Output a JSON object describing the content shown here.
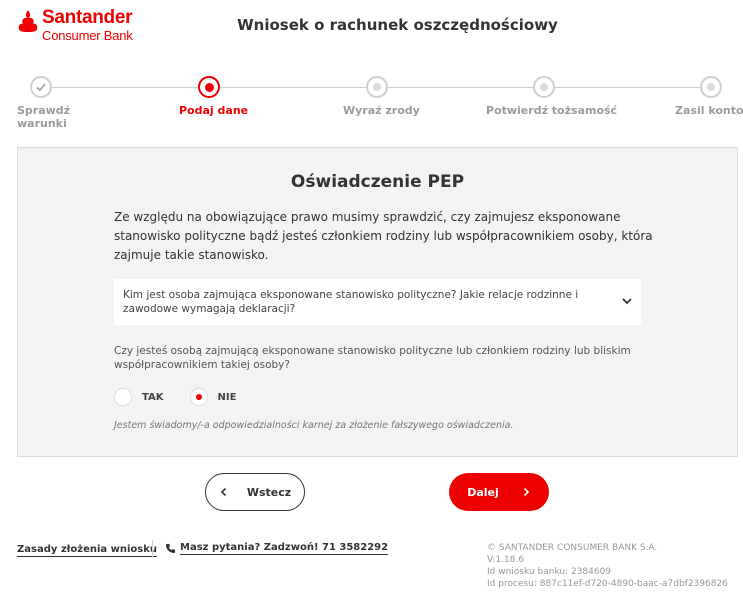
{
  "header": {
    "brand": "Santander",
    "brand_sub": "Consumer Bank",
    "title": "Wniosek o rachunek oszczędnościowy"
  },
  "stepper": {
    "steps": [
      {
        "label_line1": "Sprawdź",
        "label_line2": "warunki",
        "state": "done"
      },
      {
        "label_line1": "Podaj dane",
        "label_line2": "",
        "state": "active"
      },
      {
        "label_line1": "Wyraź zrody",
        "label_line2": "",
        "state": "pending"
      },
      {
        "label_line1": "Potwierdź tożsamość",
        "label_line2": "",
        "state": "pending"
      },
      {
        "label_line1": "Zasil konto",
        "label_line2": "",
        "state": "pending"
      }
    ]
  },
  "card": {
    "title": "Oświadczenie PEP",
    "intro": "Ze względu na obowiązujące prawo musimy sprawdzić, czy zajmujesz eksponowane stanowisko polityczne bądź jesteś członkiem rodziny lub współpracownikiem osoby, która zajmuje takie stanowisko.",
    "accordion_text": "Kim jest osoba zajmująca eksponowane stanowisko polityczne? Jakie relacje rodzinne i zawodowe wymagają deklaracji?",
    "question": "Czy jesteś osobą zajmującą eksponowane stanowisko polityczne lub członkiem rodziny lub bliskim współpracownikiem takiej osoby?",
    "options": [
      {
        "label": "TAK",
        "selected": false
      },
      {
        "label": "NIE",
        "selected": true
      }
    ],
    "declaration": "Jestem świadomy/-a odpowiedzialności karnej za złożenie fałszywego oświadczenia."
  },
  "buttons": {
    "back_label": "Wstecz",
    "next_label": "Dalej"
  },
  "footer": {
    "rules_link": "Zasady złożenia wniosku",
    "phone_link": "Masz pytania? Zadzwoń! 71 3582292",
    "copyright": "© SANTANDER CONSUMER BANK S.A.",
    "version": "V:1.18.6",
    "bank_id": "Id wniosku banku: 2384609",
    "process_id": "Id procesu: 887c11ef-d720-4890-baac-a7dbf2396826"
  },
  "colors": {
    "brand_red": "#ec0000",
    "card_bg": "#f3f3f3",
    "inactive": "#cfcfcf"
  }
}
